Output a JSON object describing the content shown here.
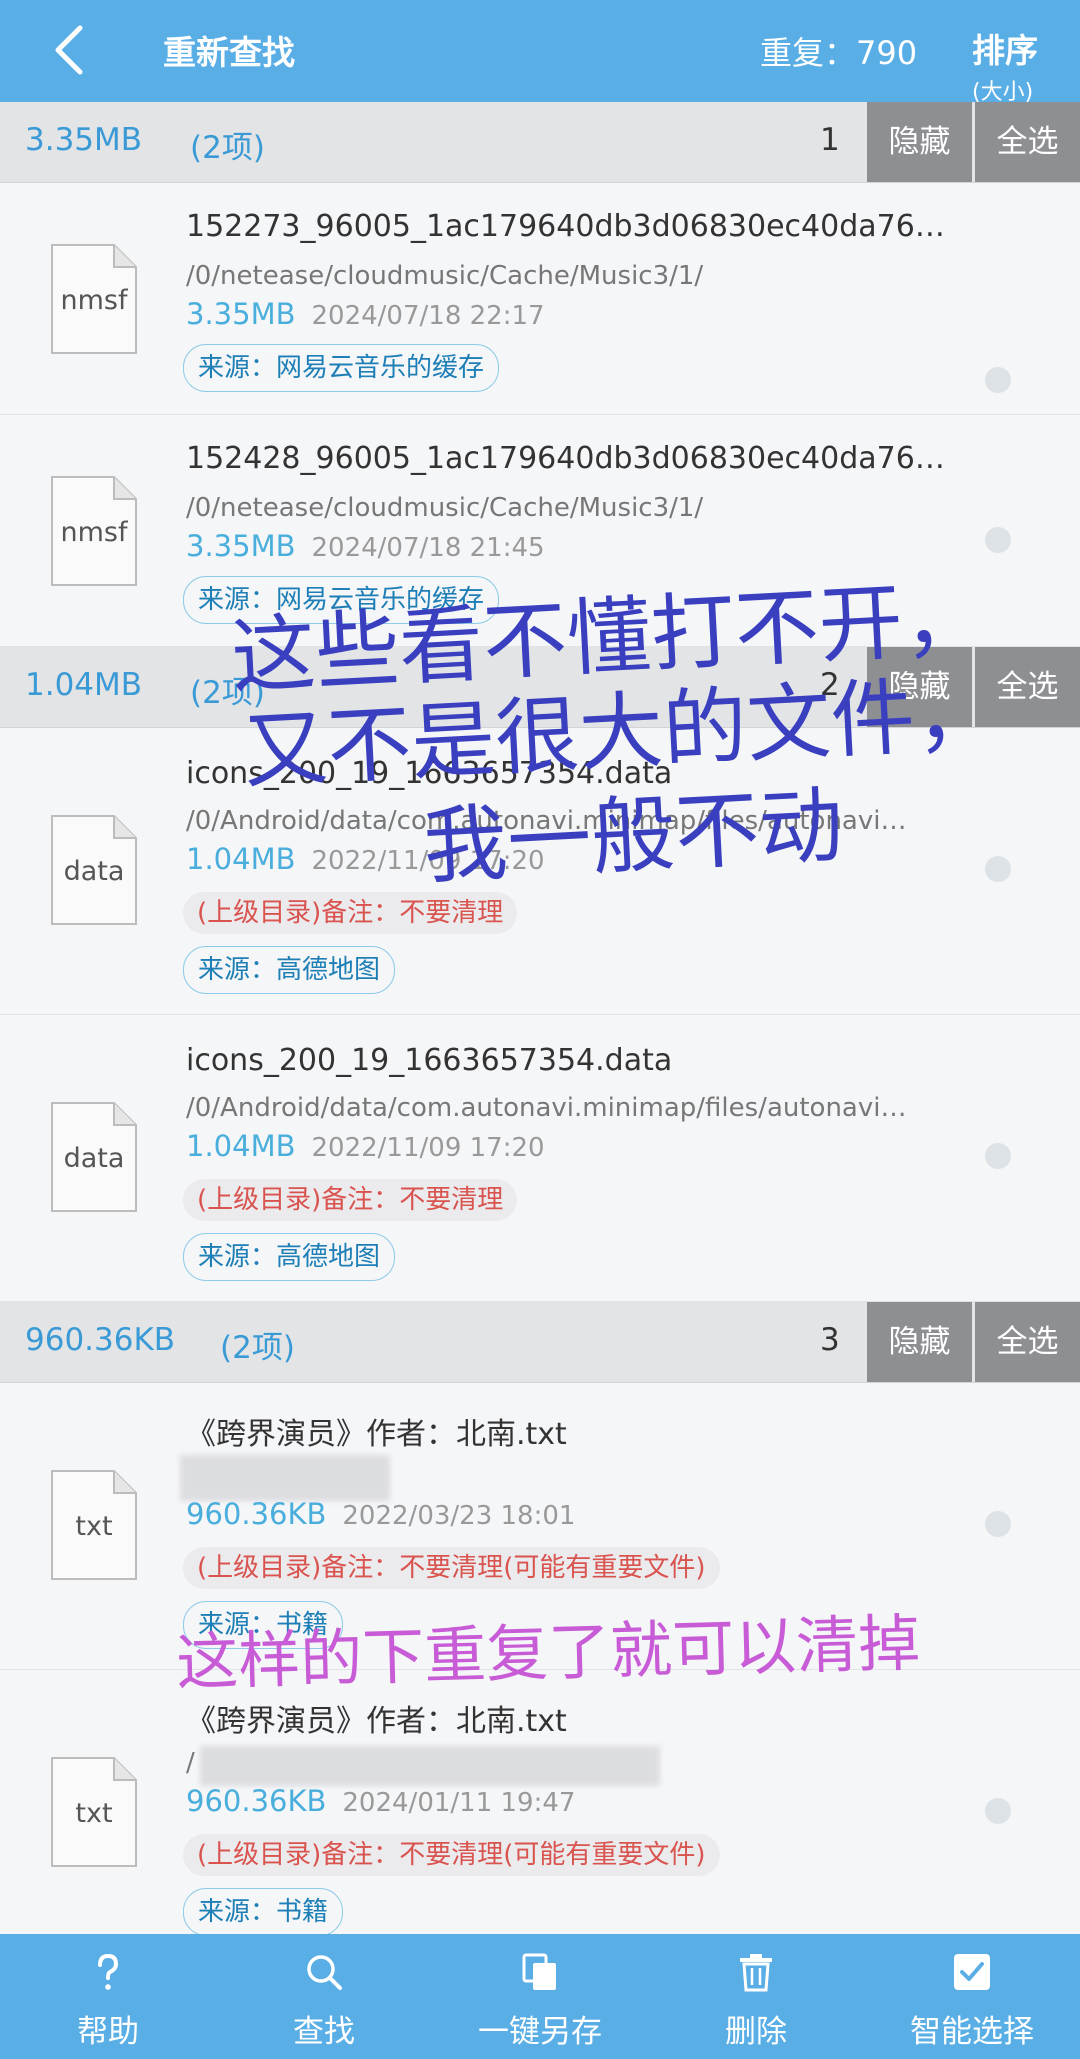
{
  "header": {
    "title": "重新查找",
    "duplicates": "重复：790",
    "sort_label": "排序",
    "sort_sub": "(大小)"
  },
  "groups": [
    {
      "size": "3.35MB",
      "count": "(2项)",
      "index": "1",
      "hide_label": "隐藏",
      "select_all_label": "全选",
      "items": [
        {
          "icon_ext": "nmsf",
          "name": "152273_96005_1ac179640db3d06830ec40da76…",
          "path": "/0/netease/cloudmusic/Cache/Music3/1/",
          "size": "3.35MB",
          "date": "2024/07/18 22:17",
          "source": "来源：网易云音乐的缓存"
        },
        {
          "icon_ext": "nmsf",
          "name": "152428_96005_1ac179640db3d06830ec40da76…",
          "path": "/0/netease/cloudmusic/Cache/Music3/1/",
          "size": "3.35MB",
          "date": "2024/07/18 21:45",
          "source": "来源：网易云音乐的缓存"
        }
      ]
    },
    {
      "size": "1.04MB",
      "count": "(2项)",
      "index": "2",
      "hide_label": "隐藏",
      "select_all_label": "全选",
      "items": [
        {
          "icon_ext": "data",
          "name": "icons_200_19_1663657354.data",
          "path": "/0/Android/data/com.autonavi.minimap/files/autonavi…",
          "size": "1.04MB",
          "date": "2022/11/09 17:20",
          "note": "(上级目录)备注：不要清理",
          "source": "来源：高德地图"
        },
        {
          "icon_ext": "data",
          "name": "icons_200_19_1663657354.data",
          "path": "/0/Android/data/com.autonavi.minimap/files/autonavi…",
          "size": "1.04MB",
          "date": "2022/11/09 17:20",
          "note": "(上级目录)备注：不要清理",
          "source": "来源：高德地图"
        }
      ]
    },
    {
      "size": "960.36KB",
      "count": "(2项)",
      "index": "3",
      "hide_label": "隐藏",
      "select_all_label": "全选",
      "items": [
        {
          "icon_ext": "txt",
          "name": "《跨界演员》作者：北南.txt",
          "path": "",
          "size": "960.36KB",
          "date": "2022/03/23 18:01",
          "note": "(上级目录)备注：不要清理(可能有重要文件)",
          "source": "来源：书籍"
        },
        {
          "icon_ext": "txt",
          "name": "《跨界演员》作者：北南.txt",
          "path": "/",
          "size": "960.36KB",
          "date": "2024/01/11 19:47",
          "note": "(上级目录)备注：不要清理(可能有重要文件)",
          "source": "来源：书籍"
        }
      ]
    }
  ],
  "annotations": {
    "line1": "这些看不懂打不开，",
    "line2": "又不是很大的文件，",
    "line3": "我一般不动",
    "line4": "这样的下重复了就可以清掉"
  },
  "bottom_nav": [
    {
      "label": "帮助",
      "icon": "help-icon"
    },
    {
      "label": "查找",
      "icon": "search-icon"
    },
    {
      "label": "一键另存",
      "icon": "copy-icon"
    },
    {
      "label": "删除",
      "icon": "trash-icon"
    },
    {
      "label": "智能选择",
      "icon": "checkbox-icon"
    }
  ],
  "colors": {
    "bar": "#5aaee6",
    "size_text": "#4aaedc",
    "note_text": "#d9534f",
    "annotation_blue": "#3a3fc0",
    "annotation_pink": "#c85bd6"
  }
}
